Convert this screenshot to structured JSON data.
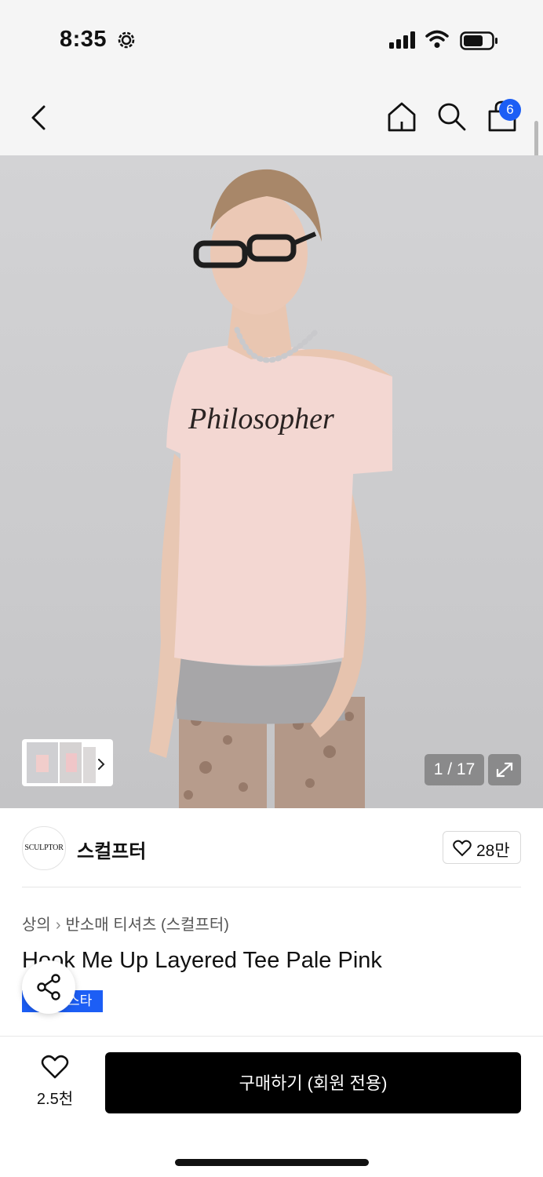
{
  "status_bar": {
    "time": "8:35"
  },
  "nav": {
    "cart_count": "6"
  },
  "gallery": {
    "counter": "1 / 17",
    "accent_color": "#1c5ef5"
  },
  "brand": {
    "logo_text": "SCULPTOR",
    "name": "스컬프터",
    "likes": "28만"
  },
  "breadcrumb": {
    "category": "상의",
    "subcategory": "반소매 티셔츠 (스컬프터)"
  },
  "product": {
    "title": "Hook Me Up Layered Tee Pale Pink",
    "tag_visible": "스타"
  },
  "bottom_bar": {
    "wish_count": "2.5천",
    "buy_label": "구매하기 (회원 전용)"
  }
}
